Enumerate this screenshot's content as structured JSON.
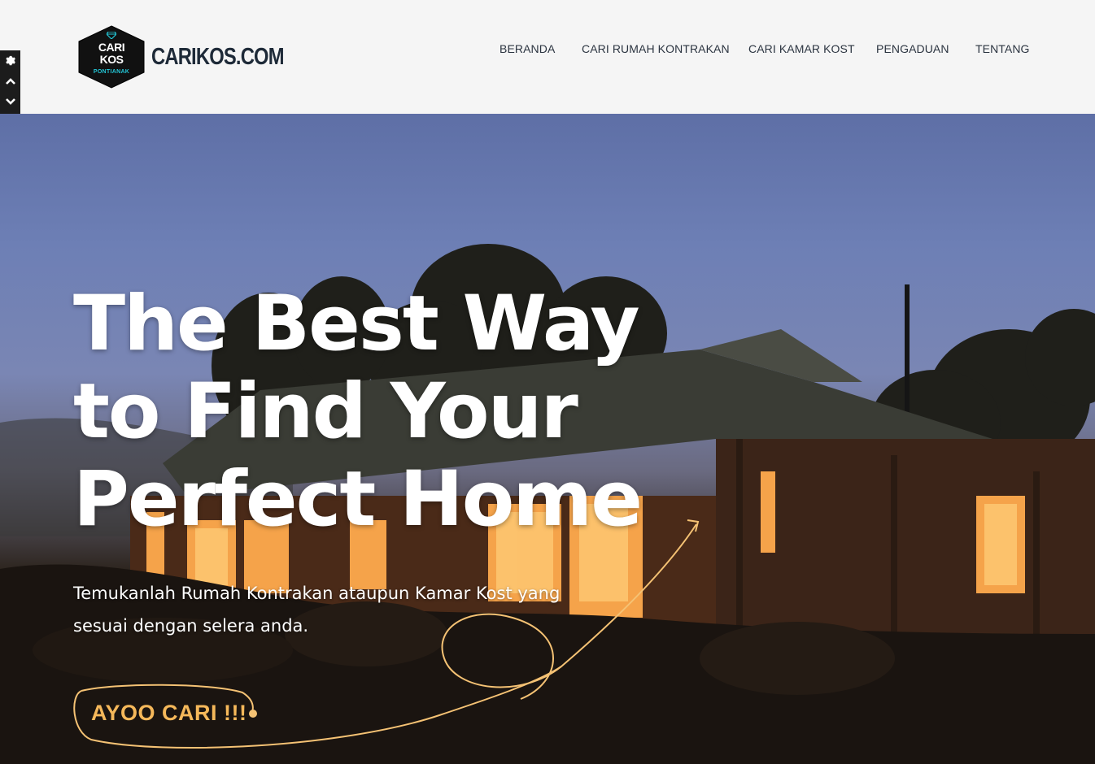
{
  "brand": {
    "logo_line1": "CARI",
    "logo_line2": "KOS",
    "logo_city": "PONTIANAK",
    "name": "CARIKOS.COM"
  },
  "nav": {
    "items": [
      {
        "label": "BERANDA"
      },
      {
        "label": "CARI RUMAH KONTRAKAN"
      },
      {
        "label": "CARI KAMAR KOST"
      },
      {
        "label": "PENGADUAN"
      },
      {
        "label": "TENTANG"
      }
    ]
  },
  "side_toolbar": {
    "icons": [
      "gear-icon",
      "chevron-up-icon",
      "chevron-down-icon",
      "chevron-right-icon"
    ]
  },
  "hero": {
    "headline_line1": "The Best Way",
    "headline_line2": "to Find Your",
    "headline_line3": "Perfect Home",
    "subtext": "Temukanlah Rumah Kontrakan ataupun Kamar Kost yang sesuai dengan selera anda.",
    "cta_label": "AYOO CARI !!!"
  },
  "colors": {
    "accent": "#f5b85a",
    "header_bg": "#f5f5f5",
    "brand_text": "#1e2a38",
    "logo_teal": "#23c6d6"
  }
}
